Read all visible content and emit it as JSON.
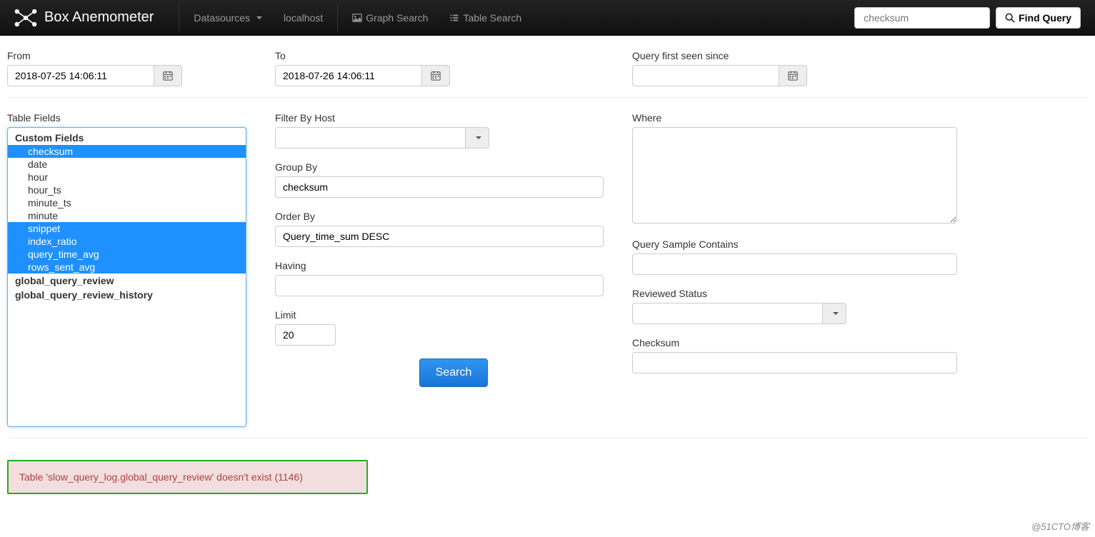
{
  "brand": "Box Anemometer",
  "nav": {
    "datasources": "Datasources",
    "localhost": "localhost",
    "graph_search": "Graph Search",
    "table_search": "Table Search",
    "search_placeholder": "checksum",
    "find_query": "Find Query"
  },
  "fields": {
    "from": {
      "label": "From",
      "value": "2018-07-25 14:06:11"
    },
    "to": {
      "label": "To",
      "value": "2018-07-26 14:06:11"
    },
    "first_seen": {
      "label": "Query first seen since",
      "value": ""
    }
  },
  "table_fields": {
    "label": "Table Fields",
    "groups": [
      {
        "name": "Custom Fields",
        "items": [
          {
            "label": "checksum",
            "selected": true
          },
          {
            "label": "date",
            "selected": false
          },
          {
            "label": "hour",
            "selected": false
          },
          {
            "label": "hour_ts",
            "selected": false
          },
          {
            "label": "minute_ts",
            "selected": false
          },
          {
            "label": "minute",
            "selected": false
          },
          {
            "label": "snippet",
            "selected": true
          },
          {
            "label": "index_ratio",
            "selected": true
          },
          {
            "label": "query_time_avg",
            "selected": true
          },
          {
            "label": "rows_sent_avg",
            "selected": true
          }
        ]
      },
      {
        "name": "global_query_review",
        "items": []
      },
      {
        "name": "global_query_review_history",
        "items": []
      }
    ]
  },
  "filters": {
    "filter_by_host": {
      "label": "Filter By Host",
      "value": ""
    },
    "group_by": {
      "label": "Group By",
      "value": "checksum"
    },
    "order_by": {
      "label": "Order By",
      "value": "Query_time_sum DESC"
    },
    "having": {
      "label": "Having",
      "value": ""
    },
    "limit": {
      "label": "Limit",
      "value": "20"
    },
    "where": {
      "label": "Where",
      "value": ""
    },
    "sample_contains": {
      "label": "Query Sample Contains",
      "value": ""
    },
    "reviewed_status": {
      "label": "Reviewed Status",
      "value": ""
    },
    "checksum": {
      "label": "Checksum",
      "value": ""
    }
  },
  "search_button": "Search",
  "error": "Table 'slow_query_log.global_query_review' doesn't exist (1146)",
  "watermark": "@51CTO博客"
}
